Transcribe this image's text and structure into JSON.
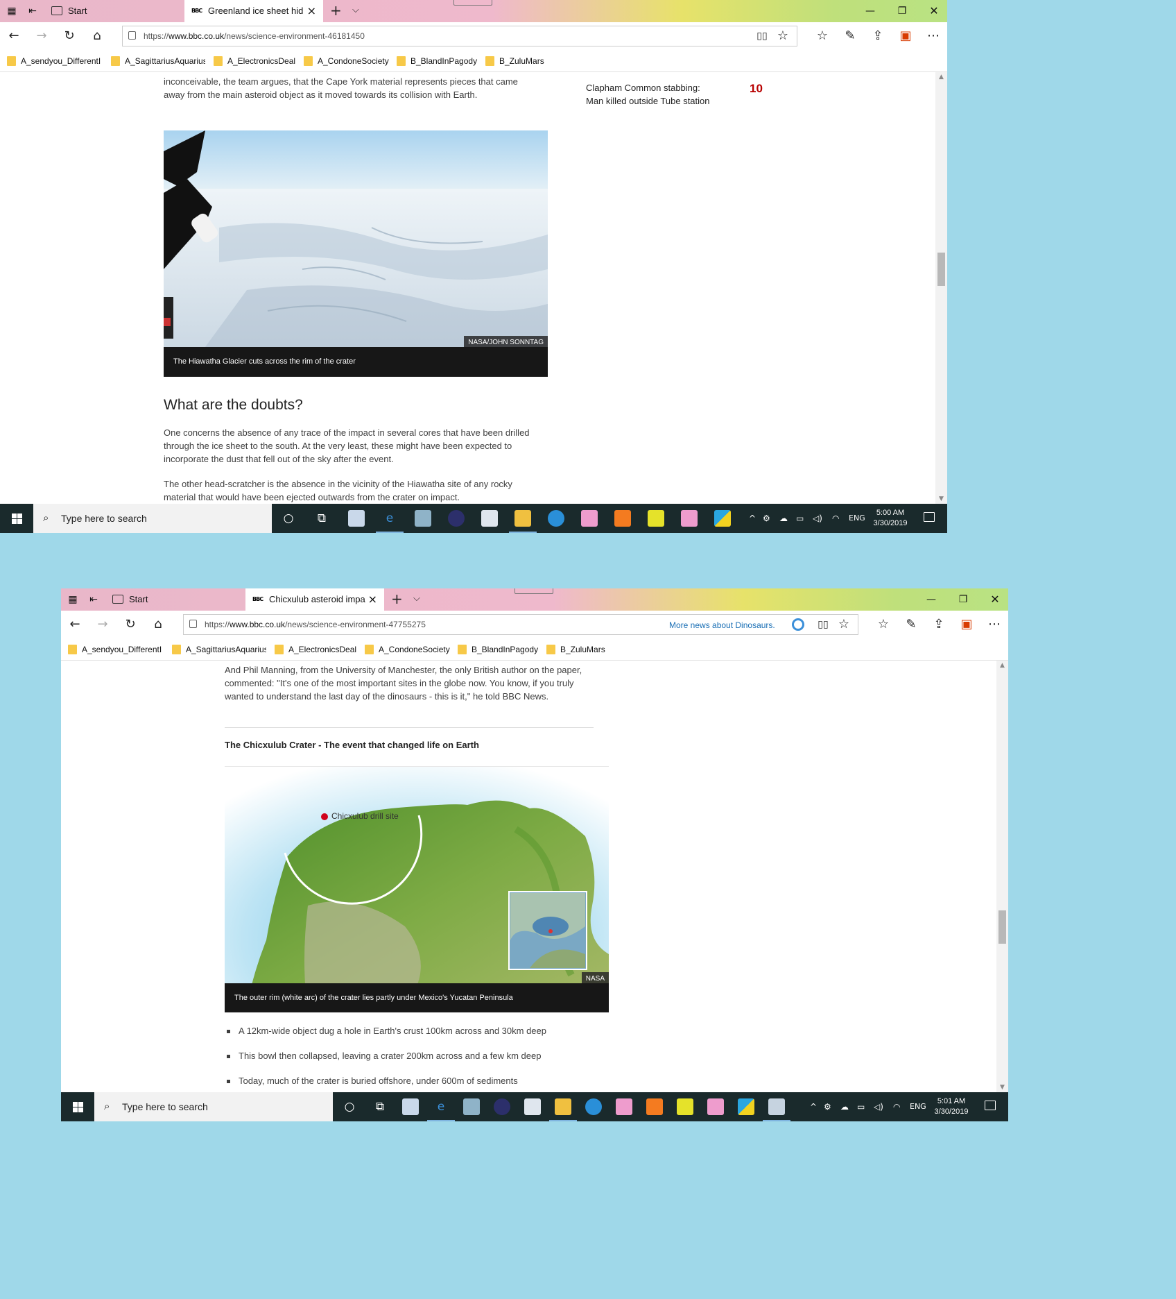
{
  "windows": [
    {
      "tabs": [
        {
          "label": "Start"
        },
        {
          "label": "Greenland ice sheet hid"
        }
      ],
      "url_prefix": "https://",
      "url_host": "www.bbc.co.uk",
      "url_path": "/news/science-environment-46181450",
      "favorites": [
        "A_sendyou_DifferentI",
        "A_SagittariusAquarius",
        "A_ElectronicsDeal",
        "A_CondoneSociety",
        "B_BlandInPagody",
        "B_ZuluMars"
      ],
      "article": {
        "intro_paragraph": "inconceivable, the team argues, that the Cape York material represents pieces that came away from the main asteroid object as it moved towards its collision with Earth.",
        "image_credit": "NASA/JOHN SONNTAG",
        "image_caption": "The Hiawatha Glacier cuts across the rim of the crater",
        "heading": "What are the doubts?",
        "paragraph_1": "One concerns the absence of any trace of the impact in several cores that have been drilled through the ice sheet to the south. At the very least, these might have been expected to incorporate the dust that fell out of the sky after the event.",
        "paragraph_2": "The other head-scratcher is the absence in the vicinity of the Hiawatha site of any rocky material that would have been ejected outwards from the crater on impact."
      },
      "most_read": {
        "title": "Clapham Common stabbing: Man killed outside Tube station",
        "rank": "10"
      },
      "taskbar": {
        "search_placeholder": "Type here to search",
        "language": "ENG",
        "time": "5:00 AM",
        "date": "3/30/2019"
      }
    },
    {
      "tabs": [
        {
          "label": "Start"
        },
        {
          "label": "Chicxulub asteroid impa"
        }
      ],
      "url_prefix": "https://",
      "url_host": "www.bbc.co.uk",
      "url_path": "/news/science-environment-47755275",
      "more_news": "More news about Dinosaurs.",
      "favorites": [
        "A_sendyou_DifferentI",
        "A_SagittariusAquarius",
        "A_ElectronicsDeal",
        "A_CondoneSociety",
        "B_BlandInPagody",
        "B_ZuluMars"
      ],
      "article": {
        "intro_paragraph": "And Phil Manning, from the University of Manchester, the only British author on the paper, commented: \"It's one of the most important sites in the globe now. You know, if you truly wanted to understand the last day of the dinosaurs - this is it,\" he told BBC News.",
        "section_title": "The Chicxulub Crater - The event that changed life on Earth",
        "map_label": "Chicxulub drill site",
        "image_credit": "NASA",
        "image_caption": "The outer rim (white arc) of the crater lies partly under Mexico's Yucatan Peninsula",
        "bullets": [
          "A 12km-wide object dug a hole in Earth's crust 100km across and 30km deep",
          "This bowl then collapsed, leaving a crater 200km across and a few km deep",
          "Today, much of the crater is buried offshore, under 600m of sediments"
        ]
      },
      "taskbar": {
        "search_placeholder": "Type here to search",
        "language": "ENG",
        "time": "5:01 AM",
        "date": "3/30/2019"
      }
    }
  ],
  "icons": {
    "back": "arrow-left-icon",
    "forward": "arrow-right-icon",
    "refresh": "refresh-icon",
    "home": "home-icon",
    "reading_view": "book-icon",
    "favorite": "star-icon",
    "favorites_hub": "favorites-list-icon",
    "notes": "pen-icon",
    "share": "share-icon",
    "office": "office-icon",
    "more": "ellipsis-icon"
  },
  "colors": {
    "desktop": "#9fd8e9",
    "taskbar": "#1a2a2c",
    "accent_red": "#b80000",
    "link_blue": "#1a6fb5"
  }
}
